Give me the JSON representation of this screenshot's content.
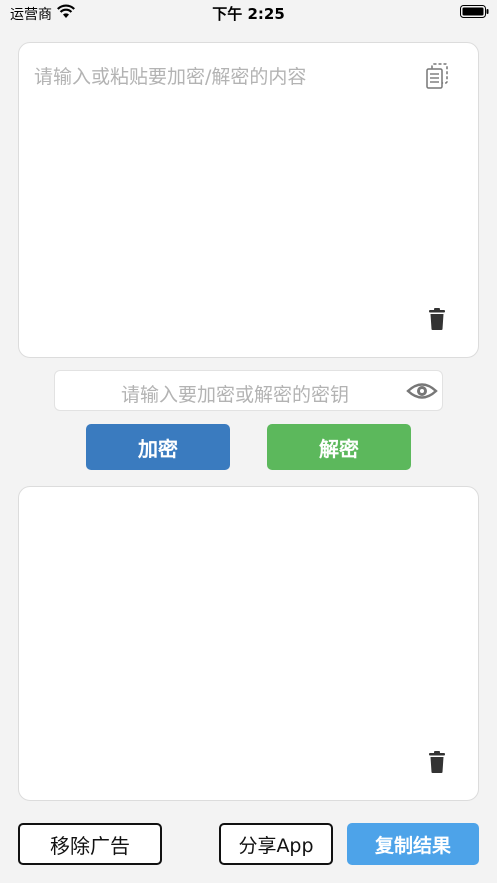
{
  "status_bar": {
    "carrier": "运营商",
    "time": "下午 2:25"
  },
  "input_area": {
    "placeholder": "请输入或粘贴要加密/解密的内容",
    "paste_icon": "paste-icon",
    "clear_icon": "trash-icon"
  },
  "key": {
    "placeholder": "请输入要加密或解密的密钥",
    "toggle_icon": "eye-icon"
  },
  "actions": {
    "encrypt_label": "加密",
    "decrypt_label": "解密",
    "encrypt_color": "#3a7bbf",
    "decrypt_color": "#5cb85c"
  },
  "output_area": {
    "value": "",
    "clear_icon": "trash-icon"
  },
  "footer": {
    "remove_ads_label": "移除广告",
    "share_label": "分享App",
    "copy_label": "复制结果",
    "copy_color": "#4da3e9"
  }
}
